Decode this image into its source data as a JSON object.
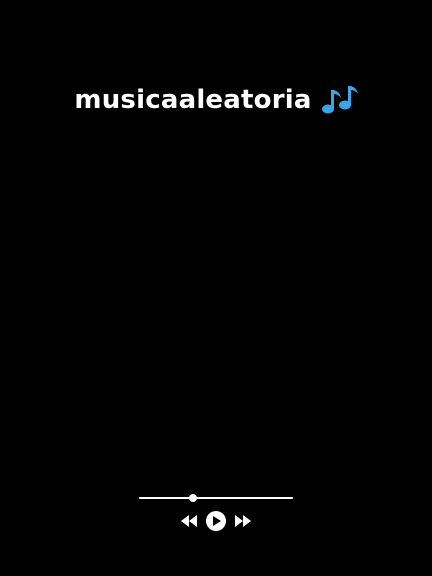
{
  "header": {
    "title": "musicaaleatoria",
    "icon": "musical-notes-icon"
  },
  "player": {
    "progress_fraction": 0.35,
    "controls": {
      "previous_icon": "rewind-icon",
      "play_icon": "play-icon",
      "next_icon": "fast-forward-icon"
    }
  },
  "colors": {
    "background": "#000000",
    "foreground": "#ffffff",
    "notes_icon": "#3aa6e8"
  }
}
